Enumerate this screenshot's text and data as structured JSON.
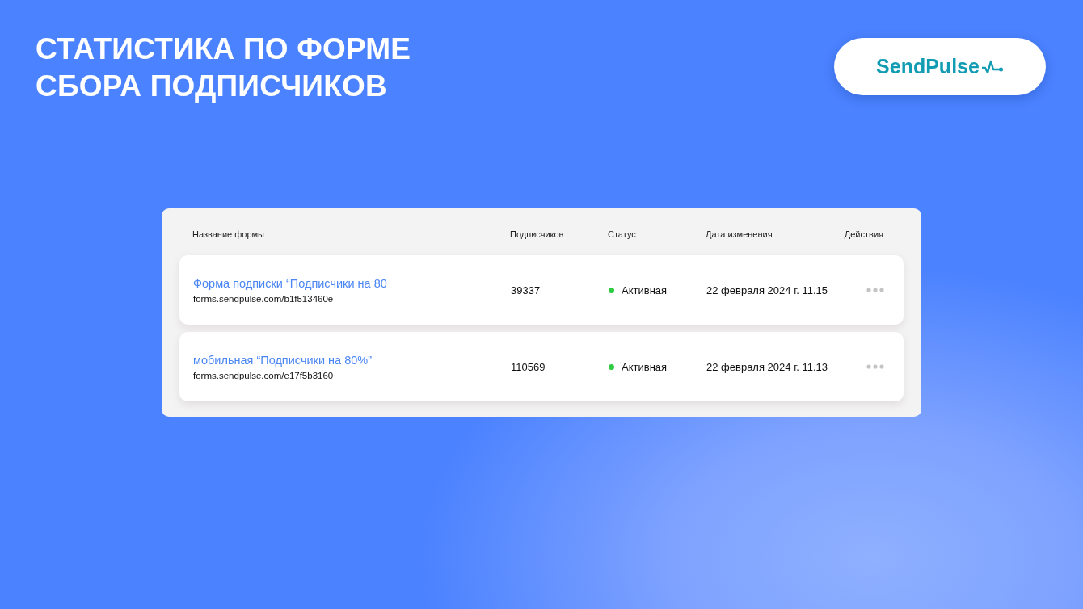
{
  "title_lines": [
    "СТАТИСТИКА ПО ФОРМЕ",
    "СБОРА ПОДПИСЧИКОВ"
  ],
  "logo": {
    "text": "SendPulse"
  },
  "table": {
    "columns": [
      "Название формы",
      "Подписчиков",
      "Статус",
      "Дата изменения",
      "Действия"
    ],
    "rows": [
      {
        "name": "Форма подписки “Подписчики на 80",
        "url": "forms.sendpulse.com/b1f513460e",
        "subscribers": "39337",
        "status": "Активная",
        "color": "#2ecc40",
        "date": "22 февраля 2024 г. 11.15"
      },
      {
        "name": "мобильная “Подписчики на 80%”",
        "url": "forms.sendpulse.com/e17f5b3160",
        "subscribers": "110569",
        "status": "Активная",
        "color": "#2ecc40",
        "date": "22 февраля 2024 г. 11.13"
      }
    ]
  }
}
